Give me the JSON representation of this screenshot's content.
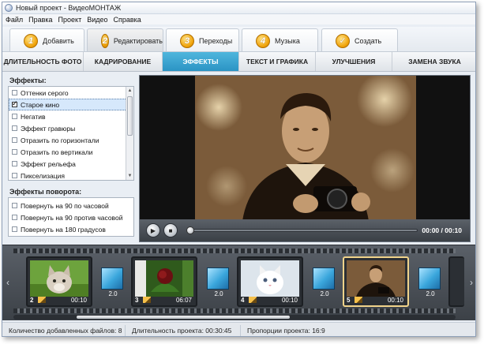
{
  "window": {
    "title": "Новый проект - ВидеоМОНТАЖ"
  },
  "menu": [
    "Файл",
    "Правка",
    "Проект",
    "Видео",
    "Справка"
  ],
  "steps": [
    {
      "num": "1",
      "label": "Добавить"
    },
    {
      "num": "2",
      "label": "Редактировать",
      "active": true
    },
    {
      "num": "3",
      "label": "Переходы"
    },
    {
      "num": "4",
      "label": "Музыка"
    },
    {
      "num": "✓",
      "label": "Создать"
    }
  ],
  "subtabs": [
    {
      "label": "ДЛИТЕЛЬНОСТЬ ФОТО"
    },
    {
      "label": "КАДРИРОВАНИЕ"
    },
    {
      "label": "ЭФФЕКТЫ",
      "active": true
    },
    {
      "label": "ТЕКСТ И ГРАФИКА"
    },
    {
      "label": "УЛУЧШЕНИЯ"
    },
    {
      "label": "ЗАМЕНА ЗВУКА"
    }
  ],
  "effects": {
    "title": "Эффекты:",
    "items": [
      {
        "label": "Оттенки серого",
        "checked": false
      },
      {
        "label": "Старое кино",
        "checked": true
      },
      {
        "label": "Негатив",
        "checked": false
      },
      {
        "label": "Эффект гравюры",
        "checked": false
      },
      {
        "label": "Отразить по горизонтали",
        "checked": false
      },
      {
        "label": "Отразить по вертикали",
        "checked": false
      },
      {
        "label": "Эффект рельефа",
        "checked": false
      },
      {
        "label": "Пикселизация",
        "checked": false
      }
    ]
  },
  "rotation": {
    "title": "Эффекты поворота:",
    "items": [
      {
        "label": "Повернуть на 90 по часовой",
        "checked": false
      },
      {
        "label": "Повернуть на 90 против часовой",
        "checked": false
      },
      {
        "label": "Повернуть на 180 градусов",
        "checked": false
      }
    ]
  },
  "player": {
    "time": "00:00 / 00:10",
    "progress": 0
  },
  "timeline": {
    "clips": [
      {
        "num": "2",
        "duration": "00:10",
        "scene": "cat"
      },
      {
        "num": "3",
        "duration": "06:07",
        "scene": "flower"
      },
      {
        "num": "4",
        "duration": "00:10",
        "scene": "kitten"
      },
      {
        "num": "5",
        "duration": "00:10",
        "scene": "photographer",
        "selected": true
      }
    ],
    "transitions": [
      "2.0",
      "2.0",
      "2.0",
      "2.0"
    ],
    "colors": {
      "selected_border": "#f0d38a",
      "transition": "#3aa6dc"
    }
  },
  "status": {
    "files": "Количество добавленных файлов: 8",
    "duration": "Длительность проекта: 00:30:45",
    "ratio": "Пропорции проекта: 16:9"
  },
  "colors": {
    "accent": "#2b94c4",
    "step_badge": "#f0a30a"
  }
}
